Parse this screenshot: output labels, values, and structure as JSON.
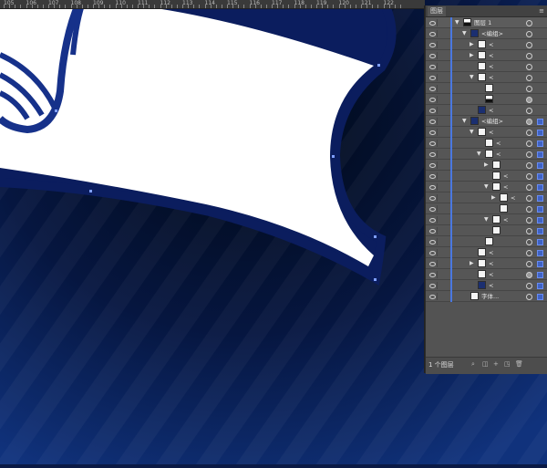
{
  "ruler": {
    "labels": [
      "105",
      "106",
      "107",
      "108",
      "109",
      "110",
      "111",
      "112",
      "113",
      "114",
      "115",
      "116",
      "117",
      "118",
      "119",
      "120",
      "121",
      "122"
    ]
  },
  "panel": {
    "tab_label": "图层",
    "menu_icon": "panel-menu-icon",
    "footer_count": "1 个图层",
    "accent_color": "#4a78e0"
  },
  "layers": [
    {
      "label": "图层 1",
      "thumb": "mixed"
    },
    {
      "label": "<编组>",
      "thumb": "dark"
    },
    {
      "label": "<",
      "thumb": "white"
    },
    {
      "label": "<",
      "thumb": "white"
    },
    {
      "label": "<",
      "thumb": "white"
    },
    {
      "label": "<",
      "thumb": "white"
    },
    {
      "label": "",
      "thumb": "white"
    },
    {
      "label": "",
      "thumb": "mixed"
    },
    {
      "label": "<",
      "thumb": "dark"
    },
    {
      "label": "<编组>",
      "thumb": "dark"
    },
    {
      "label": "<",
      "thumb": "white"
    },
    {
      "label": "<",
      "thumb": "white"
    },
    {
      "label": "<",
      "thumb": "white"
    },
    {
      "label": "",
      "thumb": "white"
    },
    {
      "label": "<",
      "thumb": "white"
    },
    {
      "label": "<",
      "thumb": "white"
    },
    {
      "label": "<",
      "thumb": "white"
    },
    {
      "label": "",
      "thumb": "white"
    },
    {
      "label": "<",
      "thumb": "white"
    },
    {
      "label": "",
      "thumb": "white"
    },
    {
      "label": "",
      "thumb": "white"
    },
    {
      "label": "<",
      "thumb": "white"
    },
    {
      "label": "<",
      "thumb": "white"
    },
    {
      "label": "<",
      "thumb": "white"
    },
    {
      "label": "<",
      "thumb": "dark"
    },
    {
      "label": "字体...",
      "thumb": "white"
    }
  ]
}
